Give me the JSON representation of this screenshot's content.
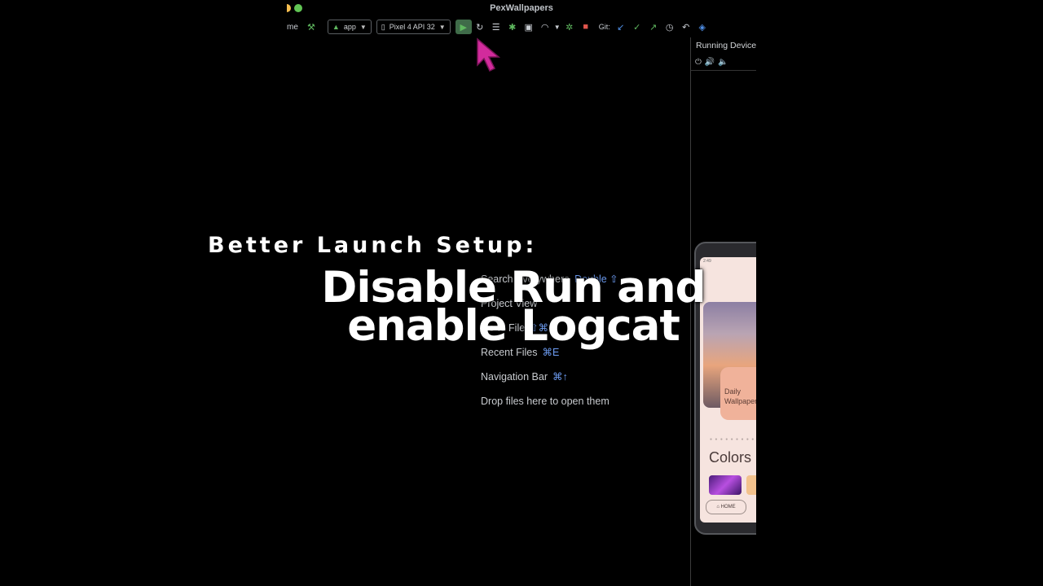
{
  "window": {
    "title": "PexWallpapers"
  },
  "toolbar": {
    "left_fragment": "me",
    "run_config": "app",
    "device": "Pixel 4 API 32",
    "git_label": "Git:"
  },
  "running_devices": {
    "header": "Running Device"
  },
  "phone": {
    "status_time": "2:49",
    "daily_card": "Daily Wallpaper",
    "colors_heading": "Colors",
    "home_button": "HOME"
  },
  "welcome": {
    "search_label": "Search Everywhere",
    "search_shortcut": "Double ⇧",
    "project_label": "Project View",
    "goto_file_label": "Go to File",
    "goto_file_shortcut": "⇧⌘O",
    "recent_label": "Recent Files",
    "recent_shortcut": "⌘E",
    "nav_label": "Navigation Bar",
    "nav_shortcut": "⌘↑",
    "drop_label": "Drop files here to open them"
  },
  "overlay": {
    "subtitle": "Better Launch Setup:",
    "title_line1": "Disable Run and",
    "title_line2": "enable Logcat"
  },
  "colors": {
    "cursor": "#d22b9c",
    "accent_blue": "#6d9cf2"
  }
}
